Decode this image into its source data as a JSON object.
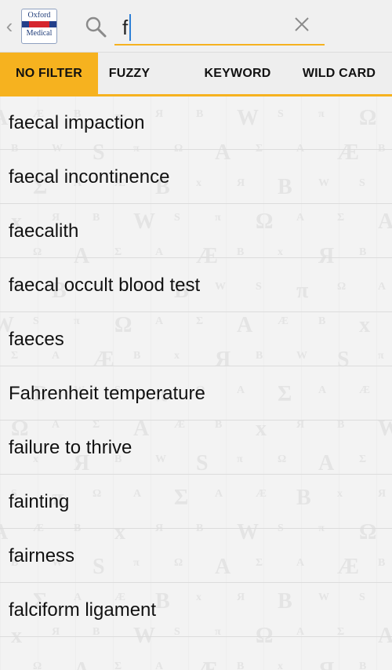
{
  "header": {
    "back_icon": "chevron-left-icon",
    "logo": {
      "line1": "Oxford",
      "line2": "Medical",
      "colors": {
        "frame": "#8ea0c0",
        "band": "#233f8a",
        "band_accent": "#d5262e"
      }
    },
    "search": {
      "value": "f",
      "placeholder": "",
      "icon": "search-icon",
      "clear_icon": "close-icon"
    }
  },
  "accent_color": "#f6b21f",
  "tabs": [
    {
      "label": "NO FILTER",
      "active": true
    },
    {
      "label": "FUZZY",
      "active": false
    },
    {
      "label": "KEYWORD",
      "active": false
    },
    {
      "label": "WILD CARD",
      "active": false
    }
  ],
  "results": [
    "faecal impaction",
    "faecal incontinence",
    "faecalith",
    "faecal occult blood test",
    "faeces",
    "Fahrenheit temperature",
    "failure to thrive",
    "fainting",
    "fairness",
    "falciform ligament"
  ]
}
